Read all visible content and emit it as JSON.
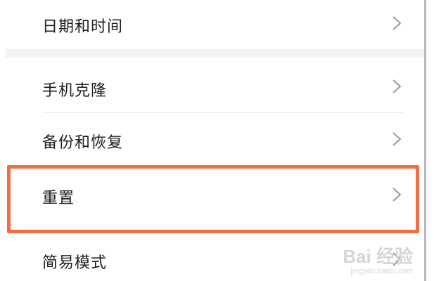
{
  "settings": {
    "items": [
      {
        "label": "日期和时间"
      },
      {
        "label": "手机克隆"
      },
      {
        "label": "备份和恢复"
      },
      {
        "label": "重置"
      },
      {
        "label": "简易模式"
      }
    ]
  },
  "icons": {
    "chevron": "chevron-right-icon"
  },
  "colors": {
    "highlight": "#f26d45",
    "text": "#1e1e1e",
    "chevron": "#9a9a9a"
  },
  "watermark": {
    "brand": "Bai 经验",
    "url": "jingyan.baidu.com"
  }
}
